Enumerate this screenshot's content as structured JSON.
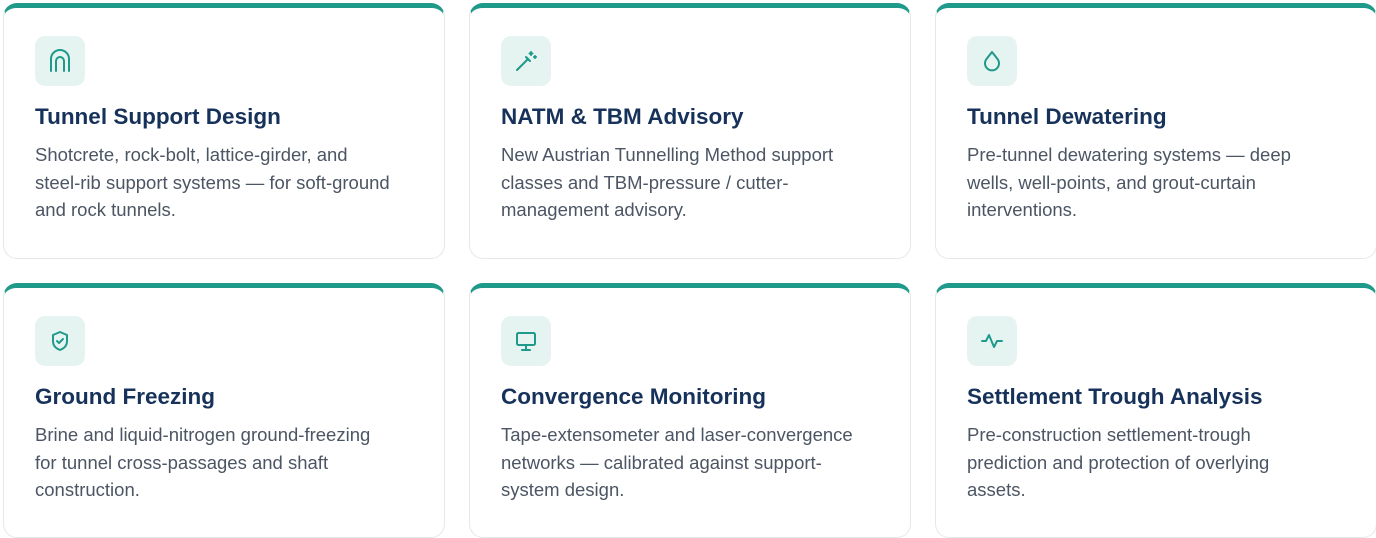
{
  "colors": {
    "accent": "#1f9a8a",
    "title": "#17325a",
    "text": "#4c5563",
    "icon_bg": "#e6f4f1"
  },
  "cards": [
    {
      "icon": "tunnel-arch-icon",
      "title": "Tunnel Support Design",
      "description": "Shotcrete, rock-bolt, lattice-girder, and steel-rib support systems — for soft-ground and rock tunnels."
    },
    {
      "icon": "wand-icon",
      "title": "NATM & TBM Advisory",
      "description": "New Austrian Tunnelling Method support classes and TBM-pressure / cutter-management advisory."
    },
    {
      "icon": "droplet-icon",
      "title": "Tunnel Dewatering",
      "description": "Pre-tunnel dewatering systems — deep wells, well-points, and grout-curtain interventions."
    },
    {
      "icon": "shield-check-icon",
      "title": "Ground Freezing",
      "description": "Brine and liquid-nitrogen ground-freezing for tunnel cross-passages and shaft construction."
    },
    {
      "icon": "monitor-icon",
      "title": "Convergence Monitoring",
      "description": "Tape-extensometer and laser-convergence networks — calibrated against support-system design."
    },
    {
      "icon": "activity-pulse-icon",
      "title": "Settlement Trough Analysis",
      "description": "Pre-construction settlement-trough prediction and protection of overlying assets."
    }
  ]
}
